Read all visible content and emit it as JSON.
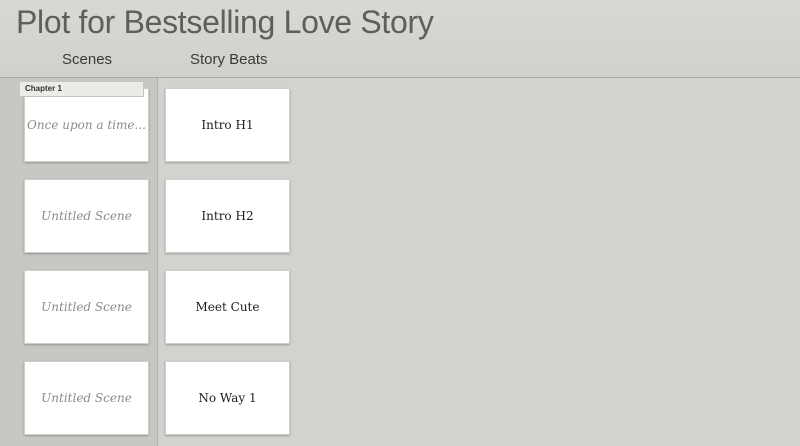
{
  "document": {
    "title": "Plot for Bestselling Love Story"
  },
  "columns": {
    "scenes_label": "Scenes",
    "beats_label": "Story Beats"
  },
  "chapter": {
    "label": "Chapter 1"
  },
  "scenes": [
    {
      "text": "Once upon a time..."
    },
    {
      "text": "Untitled Scene"
    },
    {
      "text": "Untitled Scene"
    },
    {
      "text": "Untitled Scene"
    }
  ],
  "beats": [
    {
      "text": "Intro H1"
    },
    {
      "text": "Intro H2"
    },
    {
      "text": "Meet Cute"
    },
    {
      "text": "No Way 1"
    }
  ]
}
